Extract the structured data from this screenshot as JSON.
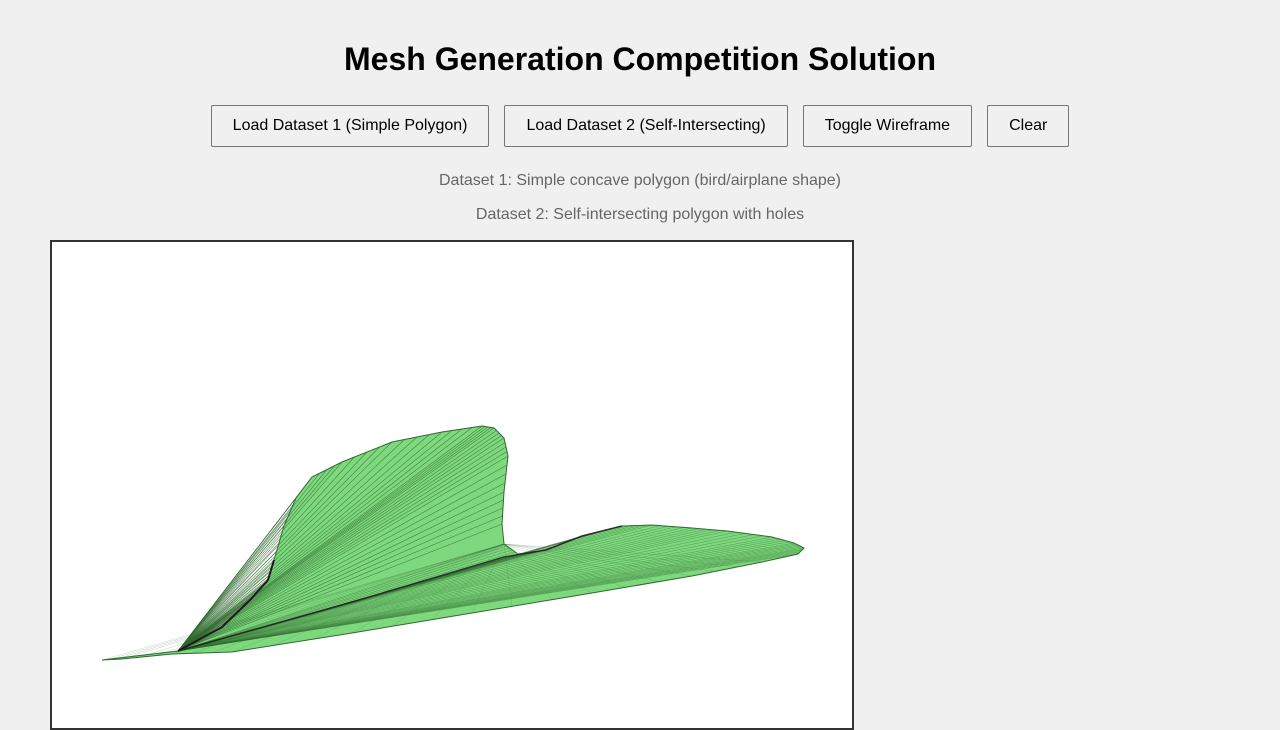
{
  "header": {
    "title": "Mesh Generation Competition Solution"
  },
  "toolbar": {
    "load_dataset_1_label": "Load Dataset 1 (Simple Polygon)",
    "load_dataset_2_label": "Load Dataset 2 (Self-Intersecting)",
    "toggle_wireframe_label": "Toggle Wireframe",
    "clear_label": "Clear"
  },
  "info": {
    "dataset_1_desc": "Dataset 1: Simple concave polygon (bird/airplane shape)",
    "dataset_2_desc": "Dataset 2: Self-intersecting polygon with holes"
  },
  "canvas": {
    "mesh_fill_color": "#7ed87e",
    "mesh_edge_color": "#2f6a2f",
    "background_color": "#ffffff",
    "wireframe": true
  }
}
